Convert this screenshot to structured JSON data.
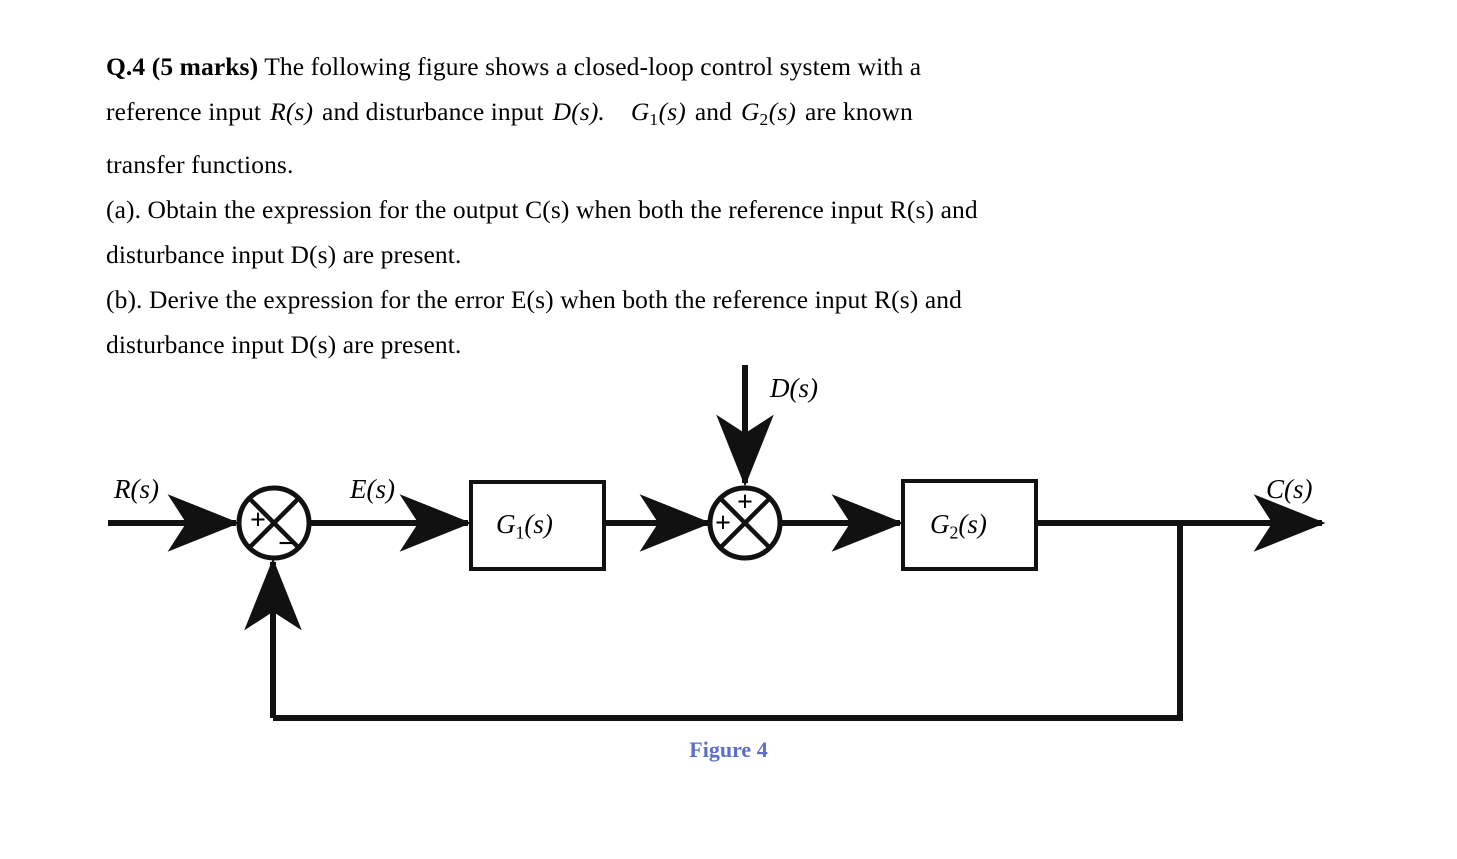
{
  "question": {
    "number": "Q.4",
    "marks_label": "(5 marks)",
    "heading_bold": "Q.4 (5 marks)",
    "intro_line1": "The following figure shows a closed-loop control system with a",
    "intro_line2_pre": "reference input",
    "intro_line2_sym1": "R(s)",
    "intro_line2_mid": "and disturbance input",
    "intro_line2_sym2": "D(s).",
    "intro_line2_sym3": "G1(s)",
    "intro_line2_and": "and",
    "intro_line2_sym4": "G2(s)",
    "intro_line2_post": "are known",
    "intro_line3": "transfer functions.",
    "part_a_line1": "(a). Obtain the expression for the output C(s) when both the reference input R(s) and",
    "part_a_line2": "disturbance input D(s) are present.",
    "part_b_line1": "(b). Derive the expression for the error E(s) when both the reference input R(s) and",
    "part_b_line2": "disturbance input D(s) are present."
  },
  "diagram": {
    "caption": "Figure 4",
    "caption_color": "#5b6fc4",
    "line_color": "#111111",
    "labels": {
      "reference_input": "R(s)",
      "error_signal": "E(s)",
      "disturbance_input": "D(s)",
      "output": "C(s)",
      "block1": "G1(s)",
      "block2": "G2(s)"
    },
    "summing_junction_1": {
      "name": "error-summing-junction",
      "sign_left": "+",
      "sign_bottom": "−"
    },
    "summing_junction_2": {
      "name": "disturbance-summing-junction",
      "sign_top": "+",
      "sign_left": "+"
    }
  }
}
